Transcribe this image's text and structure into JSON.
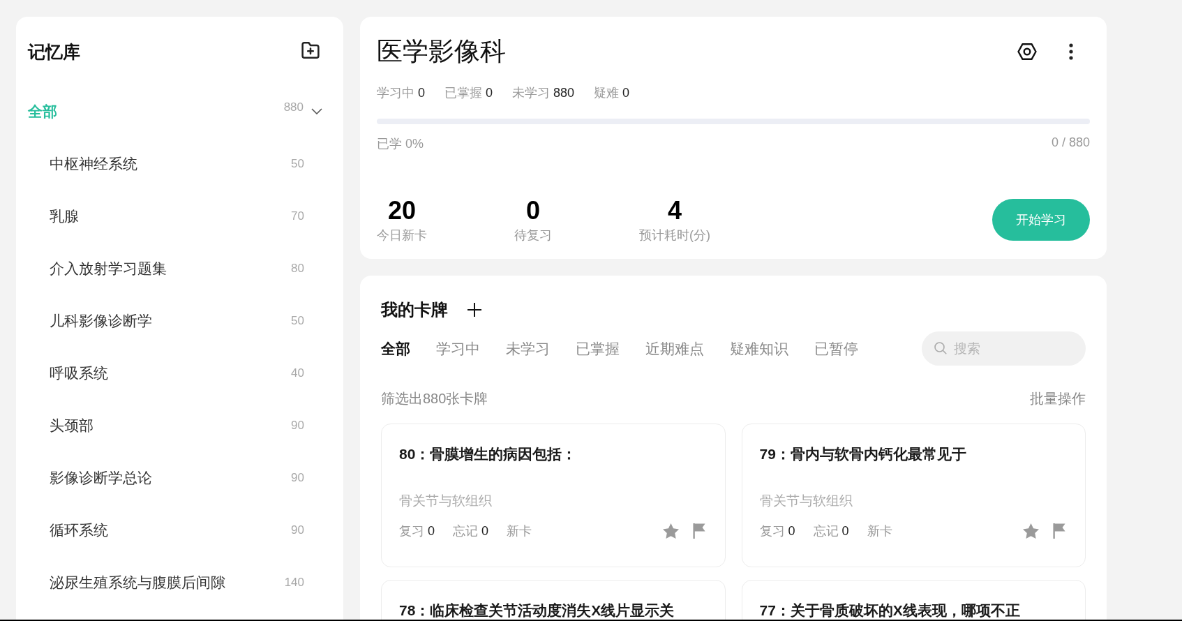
{
  "sidebar": {
    "title": "记忆库",
    "root": {
      "label": "全部",
      "count": "880",
      "selected": true,
      "expanded": true,
      "children": [
        {
          "label": "中枢神经系统",
          "count": "50",
          "selected": false
        },
        {
          "label": "乳腺",
          "count": "70",
          "selected": false
        },
        {
          "label": "介入放射学习题集",
          "count": "80",
          "selected": false
        },
        {
          "label": "儿科影像诊断学",
          "count": "50",
          "selected": false
        },
        {
          "label": "呼吸系统",
          "count": "40",
          "selected": false
        },
        {
          "label": "头颈部",
          "count": "90",
          "selected": false
        },
        {
          "label": "影像诊断学总论",
          "count": "90",
          "selected": false
        },
        {
          "label": "循环系统",
          "count": "90",
          "selected": false
        },
        {
          "label": "泌尿生殖系统与腹膜后间隙",
          "count": "140",
          "selected": false
        }
      ]
    }
  },
  "deck": {
    "title": "医学影像科",
    "stats": [
      {
        "label": "学习中",
        "value": "0"
      },
      {
        "label": "已掌握",
        "value": "0"
      },
      {
        "label": "未学习",
        "value": "880"
      },
      {
        "label": "疑难",
        "value": "0"
      }
    ],
    "progress": {
      "level": 0,
      "label": "已学 0%",
      "count": "0 / 880"
    },
    "summary": [
      {
        "value": "20",
        "label": "今日新卡"
      },
      {
        "value": "0",
        "label": "待复习"
      },
      {
        "value": "4",
        "label": "预计耗时(分)"
      }
    ],
    "start_button": "开始学习"
  },
  "cards_panel": {
    "title": "我的卡牌",
    "tabs": [
      {
        "label": "全部",
        "selected": true
      },
      {
        "label": "学习中",
        "selected": false
      },
      {
        "label": "未学习",
        "selected": false
      },
      {
        "label": "已掌握",
        "selected": false
      },
      {
        "label": "近期难点",
        "selected": false
      },
      {
        "label": "疑难知识",
        "selected": false
      },
      {
        "label": "已暂停",
        "selected": false
      }
    ],
    "search": {
      "placeholder": "搜索"
    },
    "filter_summary": "筛选出880张卡牌",
    "batch_action": "批量操作",
    "cards": [
      {
        "title": "80：骨膜增生的病因包括：",
        "category": "骨关节与软组织",
        "stats": [
          {
            "label": "复习",
            "value": "0"
          },
          {
            "label": "忘记",
            "value": "0"
          }
        ],
        "status": "新卡",
        "starred": false,
        "flagged": false
      },
      {
        "title": "79：骨内与软骨内钙化最常见于",
        "category": "骨关节与软组织",
        "stats": [
          {
            "label": "复习",
            "value": "0"
          },
          {
            "label": "忘记",
            "value": "0"
          }
        ],
        "status": "新卡",
        "starred": false,
        "flagged": false
      },
      {
        "title": "78：临床检查关节活动度消失X线片显示关"
      },
      {
        "title": "77：关于骨质破坏的X线表现，哪项不正"
      }
    ]
  }
}
